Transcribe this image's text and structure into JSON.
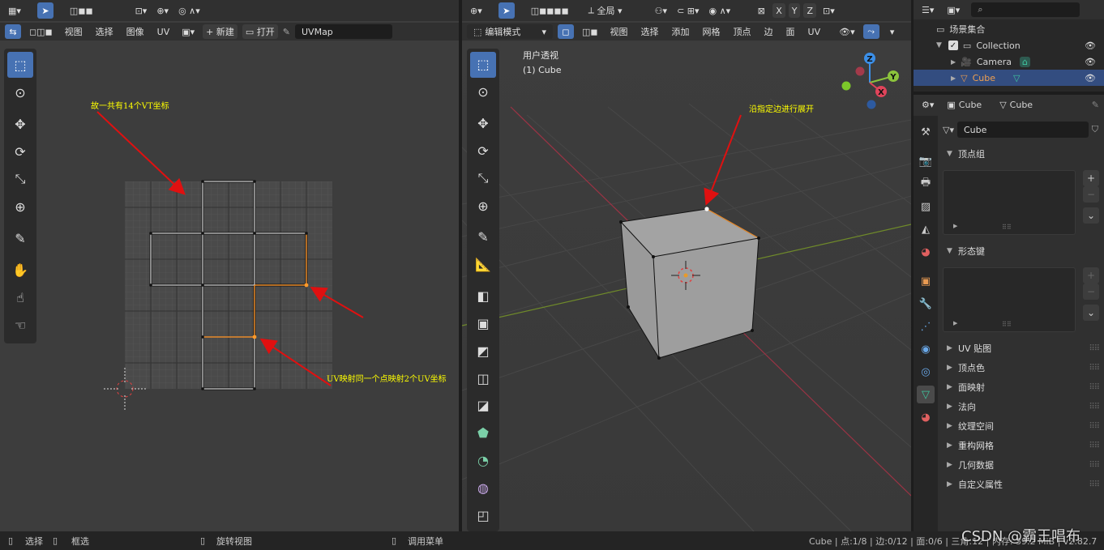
{
  "uv_editor": {
    "header_menus": [
      "视图",
      "选择",
      "图像",
      "UV"
    ],
    "new_label": "新建",
    "open_label": "打开",
    "uvmap_name": "UVMap",
    "annotations": {
      "top": "故一共有14个VT坐标",
      "bottom": "UV映射同一个点映射2个UV坐标"
    }
  },
  "viewport": {
    "orientation_label": "全局",
    "mode_label": "编辑模式",
    "header_menus": [
      "视图",
      "选择",
      "添加",
      "网格",
      "顶点",
      "边",
      "面",
      "UV"
    ],
    "xyz": [
      "X",
      "Y",
      "Z"
    ],
    "overlay_view_name": "用户透视",
    "overlay_object": "(1) Cube",
    "annotation": "沿指定边进行展开",
    "gizmo": {
      "x": "X",
      "y": "Y",
      "z": "Z"
    }
  },
  "outliner": {
    "root": "场景集合",
    "items": [
      {
        "label": "Collection"
      },
      {
        "label": "Camera"
      },
      {
        "label": "Cube",
        "selected": true
      }
    ]
  },
  "properties": {
    "context_object": "Cube",
    "context_data": "Cube",
    "mesh_name": "Cube",
    "sections": [
      {
        "label": "顶点组",
        "open": true
      },
      {
        "label": "形态键",
        "open": true
      },
      {
        "label": "UV 贴图",
        "open": false
      },
      {
        "label": "顶点色",
        "open": false
      },
      {
        "label": "面映射",
        "open": false
      },
      {
        "label": "法向",
        "open": false
      },
      {
        "label": "纹理空间",
        "open": false
      },
      {
        "label": "重构网格",
        "open": false
      },
      {
        "label": "几何数据",
        "open": false
      },
      {
        "label": "自定义属性",
        "open": false
      }
    ],
    "tab_colors": {
      "active": "#4772b3",
      "data": "#3fc7a0"
    }
  },
  "status_bar": {
    "select": "选择",
    "box_select": "框选",
    "rotate_view": "旋转视图",
    "call_menu": "调用菜单",
    "stats": "Cube | 点:1/8 | 边:0/12 | 面:0/6 | 三角:12 | 内存: 39.2 MiB | v2.82.7",
    "watermark": "CSDN @霸王唱布"
  },
  "colors": {
    "accent": "#4772b3",
    "annotation_text": "#ffff00",
    "annotation_arrow": "#e01010",
    "uv_selected_edge": "#e88a2a",
    "x_axis": "#e0445a",
    "y_axis": "#8cc33c",
    "z_axis": "#3b8fe8"
  }
}
